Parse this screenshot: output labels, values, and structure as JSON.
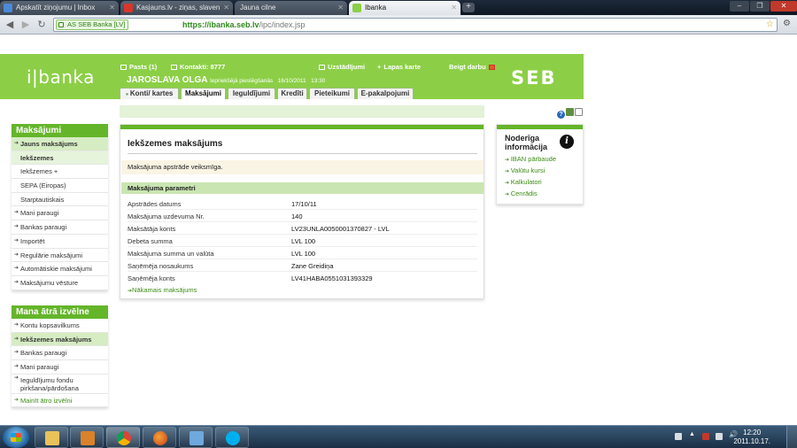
{
  "browser": {
    "tabs": [
      {
        "title": "Apskatīt ziņojumu | Inbox",
        "favicon_color": "#4a8ad8"
      },
      {
        "title": "Kasjauns.lv - ziņas, slaven",
        "favicon_color": "#d9362b"
      },
      {
        "title": "Jauna cilne",
        "favicon_color": ""
      },
      {
        "title": "Ibanka",
        "favicon_color": "#8ccf46"
      }
    ],
    "new_tab": "+",
    "ev_badge": "AS SEB Banka [LV]",
    "url_scheme": "https://",
    "url_host": "ibanka.seb.lv",
    "url_path": "/ipc/index.jsp"
  },
  "header": {
    "logo": "i|banka",
    "seb_logo": "SEB",
    "links": {
      "mail": "Pasts (1)",
      "contacts": "Kontakti: 8777",
      "settings": "Uzstādījumi",
      "favorites": "Lapas karte",
      "logout": "Beigt darbu"
    },
    "user_name": "JAROSLAVA OLGA",
    "last_login_label": "Iepriekšējā pieslēgšanās",
    "last_login_date": "16/10/2011",
    "last_login_time": "13:30"
  },
  "main_tabs": [
    {
      "label": "Konti/ kartes"
    },
    {
      "label": "Maksājumi"
    },
    {
      "label": "Ieguldījumi"
    },
    {
      "label": "Kredīti"
    },
    {
      "label": "Pieteikumi"
    },
    {
      "label": "E-pakalpojumi"
    }
  ],
  "sidebar_payments": {
    "title": "Maksājumi",
    "items": [
      {
        "label": "Jauns maksājums"
      },
      {
        "label": "Iekšzemes"
      },
      {
        "label": "Iekšzemes +"
      },
      {
        "label": "SEPA (Eiropas)"
      },
      {
        "label": "Starptautiskais"
      },
      {
        "label": "Mani paraugi"
      },
      {
        "label": "Bankas paraugi"
      },
      {
        "label": "Importēt"
      },
      {
        "label": "Regulārie maksājumi"
      },
      {
        "label": "Automātiskie maksājumi"
      },
      {
        "label": "Maksājumu vēsture"
      }
    ]
  },
  "sidebar_quick": {
    "title": "Mana ātrā izvēlne",
    "items": [
      {
        "label": "Kontu kopsavilkums"
      },
      {
        "label": "Iekšzemes maksājums"
      },
      {
        "label": "Bankas paraugi"
      },
      {
        "label": "Mani paraugi"
      },
      {
        "label": "Ieguldījumu fondu pirkšana/pārdošana"
      },
      {
        "label": "Mainīt ātro izvēlni"
      }
    ]
  },
  "content": {
    "title": "Iekšzemes maksājums",
    "notice": "Maksājuma apstrāde veiksmīga.",
    "section": "Maksājuma parametri",
    "params": [
      {
        "label": "Apstrādes datums",
        "value": "17/10/11"
      },
      {
        "label": "Maksājuma uzdevuma Nr.",
        "value": "140"
      },
      {
        "label": "Maksātāja konts",
        "value": "LV23UNLA0050001370827 - LVL"
      },
      {
        "label": "Debeta summa",
        "value": "LVL  100"
      },
      {
        "label": "Maksājuma summa un valūta",
        "value": "LVL  100"
      },
      {
        "label": "Saņēmēja nosaukums",
        "value": "Zane Greidiņa"
      },
      {
        "label": "Saņēmēja konts",
        "value": "LV41HABA0551031393329"
      }
    ],
    "next_link": "Nākamais maksājums"
  },
  "info": {
    "title": "Noderīga informācija",
    "links": [
      {
        "label": "IBAN pārbaude"
      },
      {
        "label": "Valūtu kursi"
      },
      {
        "label": "Kalkulatori"
      },
      {
        "label": "Cenrādis"
      }
    ]
  },
  "taskbar": {
    "time": "12:20",
    "date": "2011.10.17."
  },
  "colors": {
    "brand_green": "#8ccf46",
    "accent_green": "#64b52a",
    "link_green": "#3c8c17"
  }
}
